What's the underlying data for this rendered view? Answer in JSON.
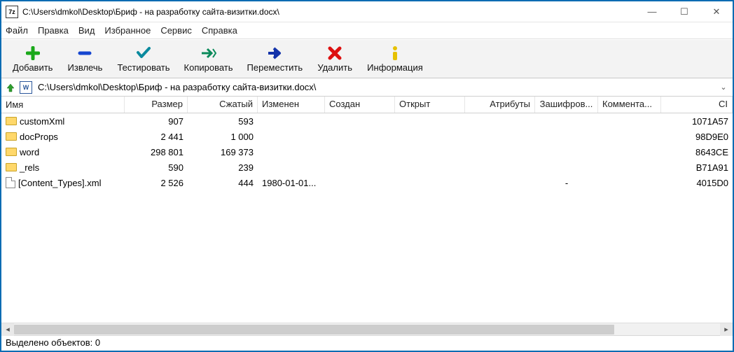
{
  "window": {
    "title": "C:\\Users\\dmkol\\Desktop\\Бриф - на разработку сайта-визитки.docx\\",
    "app_icon_label": "7z"
  },
  "menu": {
    "file": "Файл",
    "edit": "Правка",
    "view": "Вид",
    "favorites": "Избранное",
    "tools": "Сервис",
    "help": "Справка"
  },
  "toolbar": {
    "add": "Добавить",
    "extract": "Извлечь",
    "test": "Тестировать",
    "copy": "Копировать",
    "move": "Переместить",
    "delete": "Удалить",
    "info": "Информация"
  },
  "path": "C:\\Users\\dmkol\\Desktop\\Бриф - на разработку сайта-визитки.docx\\",
  "columns": {
    "name": "Имя",
    "size": "Размер",
    "packed": "Сжатый",
    "modified": "Изменен",
    "created": "Создан",
    "accessed": "Открыт",
    "attributes": "Атрибуты",
    "encrypted": "Зашифров...",
    "comment": "Коммента...",
    "crc": "CI"
  },
  "rows": [
    {
      "icon": "folder",
      "name": "customXml",
      "size": "907",
      "packed": "593",
      "modified": "",
      "created": "",
      "accessed": "",
      "attr": "",
      "enc": "",
      "comment": "",
      "crc": "1071A57"
    },
    {
      "icon": "folder",
      "name": "docProps",
      "size": "2 441",
      "packed": "1 000",
      "modified": "",
      "created": "",
      "accessed": "",
      "attr": "",
      "enc": "",
      "comment": "",
      "crc": "98D9E0"
    },
    {
      "icon": "folder",
      "name": "word",
      "size": "298 801",
      "packed": "169 373",
      "modified": "",
      "created": "",
      "accessed": "",
      "attr": "",
      "enc": "",
      "comment": "",
      "crc": "8643CE"
    },
    {
      "icon": "folder",
      "name": "_rels",
      "size": "590",
      "packed": "239",
      "modified": "",
      "created": "",
      "accessed": "",
      "attr": "",
      "enc": "",
      "comment": "",
      "crc": "B71A91"
    },
    {
      "icon": "file",
      "name": "[Content_Types].xml",
      "size": "2 526",
      "packed": "444",
      "modified": "1980-01-01...",
      "created": "",
      "accessed": "",
      "attr": "",
      "enc": "-",
      "comment": "",
      "crc": "4015D0"
    }
  ],
  "status": "Выделено объектов: 0"
}
